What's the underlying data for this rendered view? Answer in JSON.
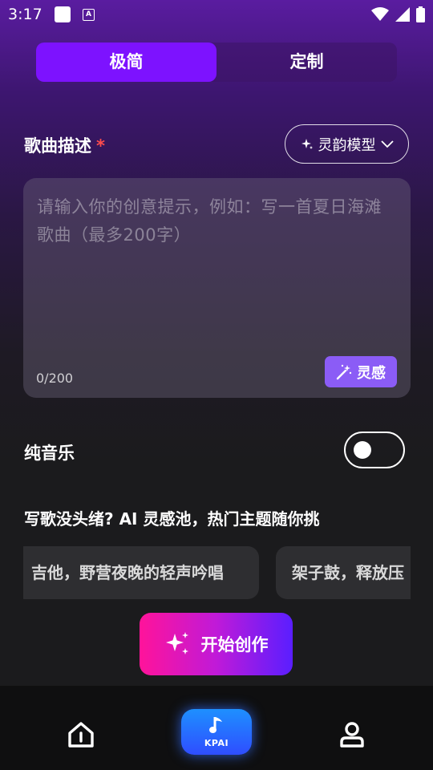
{
  "status_bar": {
    "time": "3:17",
    "icons": [
      "notification-box-icon",
      "keyboard-a-icon",
      "wifi-icon",
      "signal-icon",
      "battery-icon"
    ]
  },
  "tabs": [
    {
      "label": "极简",
      "active": true
    },
    {
      "label": "定制",
      "active": false
    }
  ],
  "song_description": {
    "title": "歌曲描述",
    "required_mark": "*"
  },
  "model_selector": {
    "label": "灵韵模型",
    "icon": "sparkle-icon"
  },
  "prompt": {
    "placeholder": "请输入你的创意提示，例如：写一首夏日海滩歌曲（最多200字）",
    "value": "",
    "counter": "0/200",
    "inspire_label": "灵感"
  },
  "pure_music": {
    "label": "纯音乐",
    "enabled": false
  },
  "inspiration_pool": {
    "title": "写歌没头绪? AI 灵感池，热门主题随你挑",
    "chips": [
      "吉他，野营夜晚的轻声吟唱",
      "架子鼓，释放压"
    ]
  },
  "start_button": {
    "label": "开始创作"
  },
  "bottom_nav": {
    "items": [
      {
        "icon": "home-icon"
      },
      {
        "icon": "music-note-icon",
        "label": "KPAI"
      },
      {
        "icon": "user-icon"
      }
    ]
  },
  "colors": {
    "accent": "#7d12ff",
    "inspire": "#8b5cf6",
    "required": "#ff4d4d"
  }
}
